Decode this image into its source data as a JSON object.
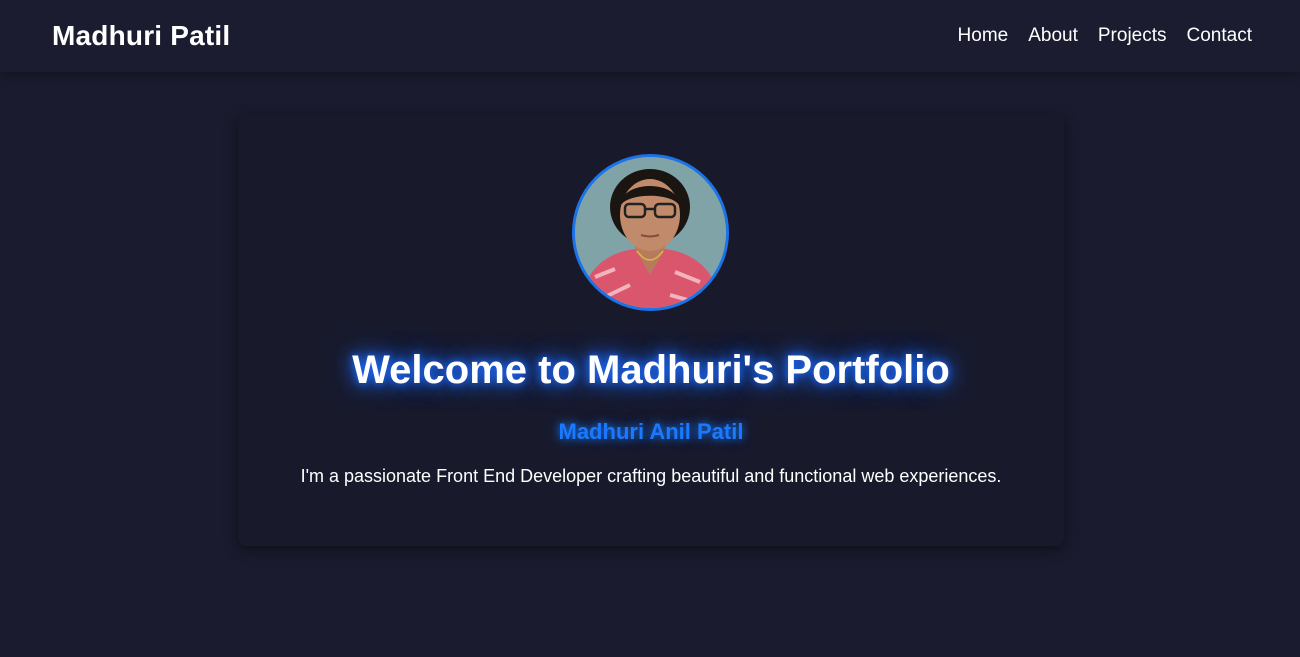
{
  "header": {
    "brand": "Madhuri Patil",
    "nav": [
      {
        "label": "Home"
      },
      {
        "label": "About"
      },
      {
        "label": "Projects"
      },
      {
        "label": "Contact"
      }
    ]
  },
  "hero": {
    "avatar_alt": "Madhuri Patil profile photo",
    "title": "Welcome to Madhuri's Portfolio",
    "name": "Madhuri Anil Patil",
    "description": "I'm a passionate Front End Developer crafting beautiful and functional web experiences."
  },
  "colors": {
    "background": "#1a1b2e",
    "accent": "#1a73e8",
    "glow": "#1e6bff"
  }
}
